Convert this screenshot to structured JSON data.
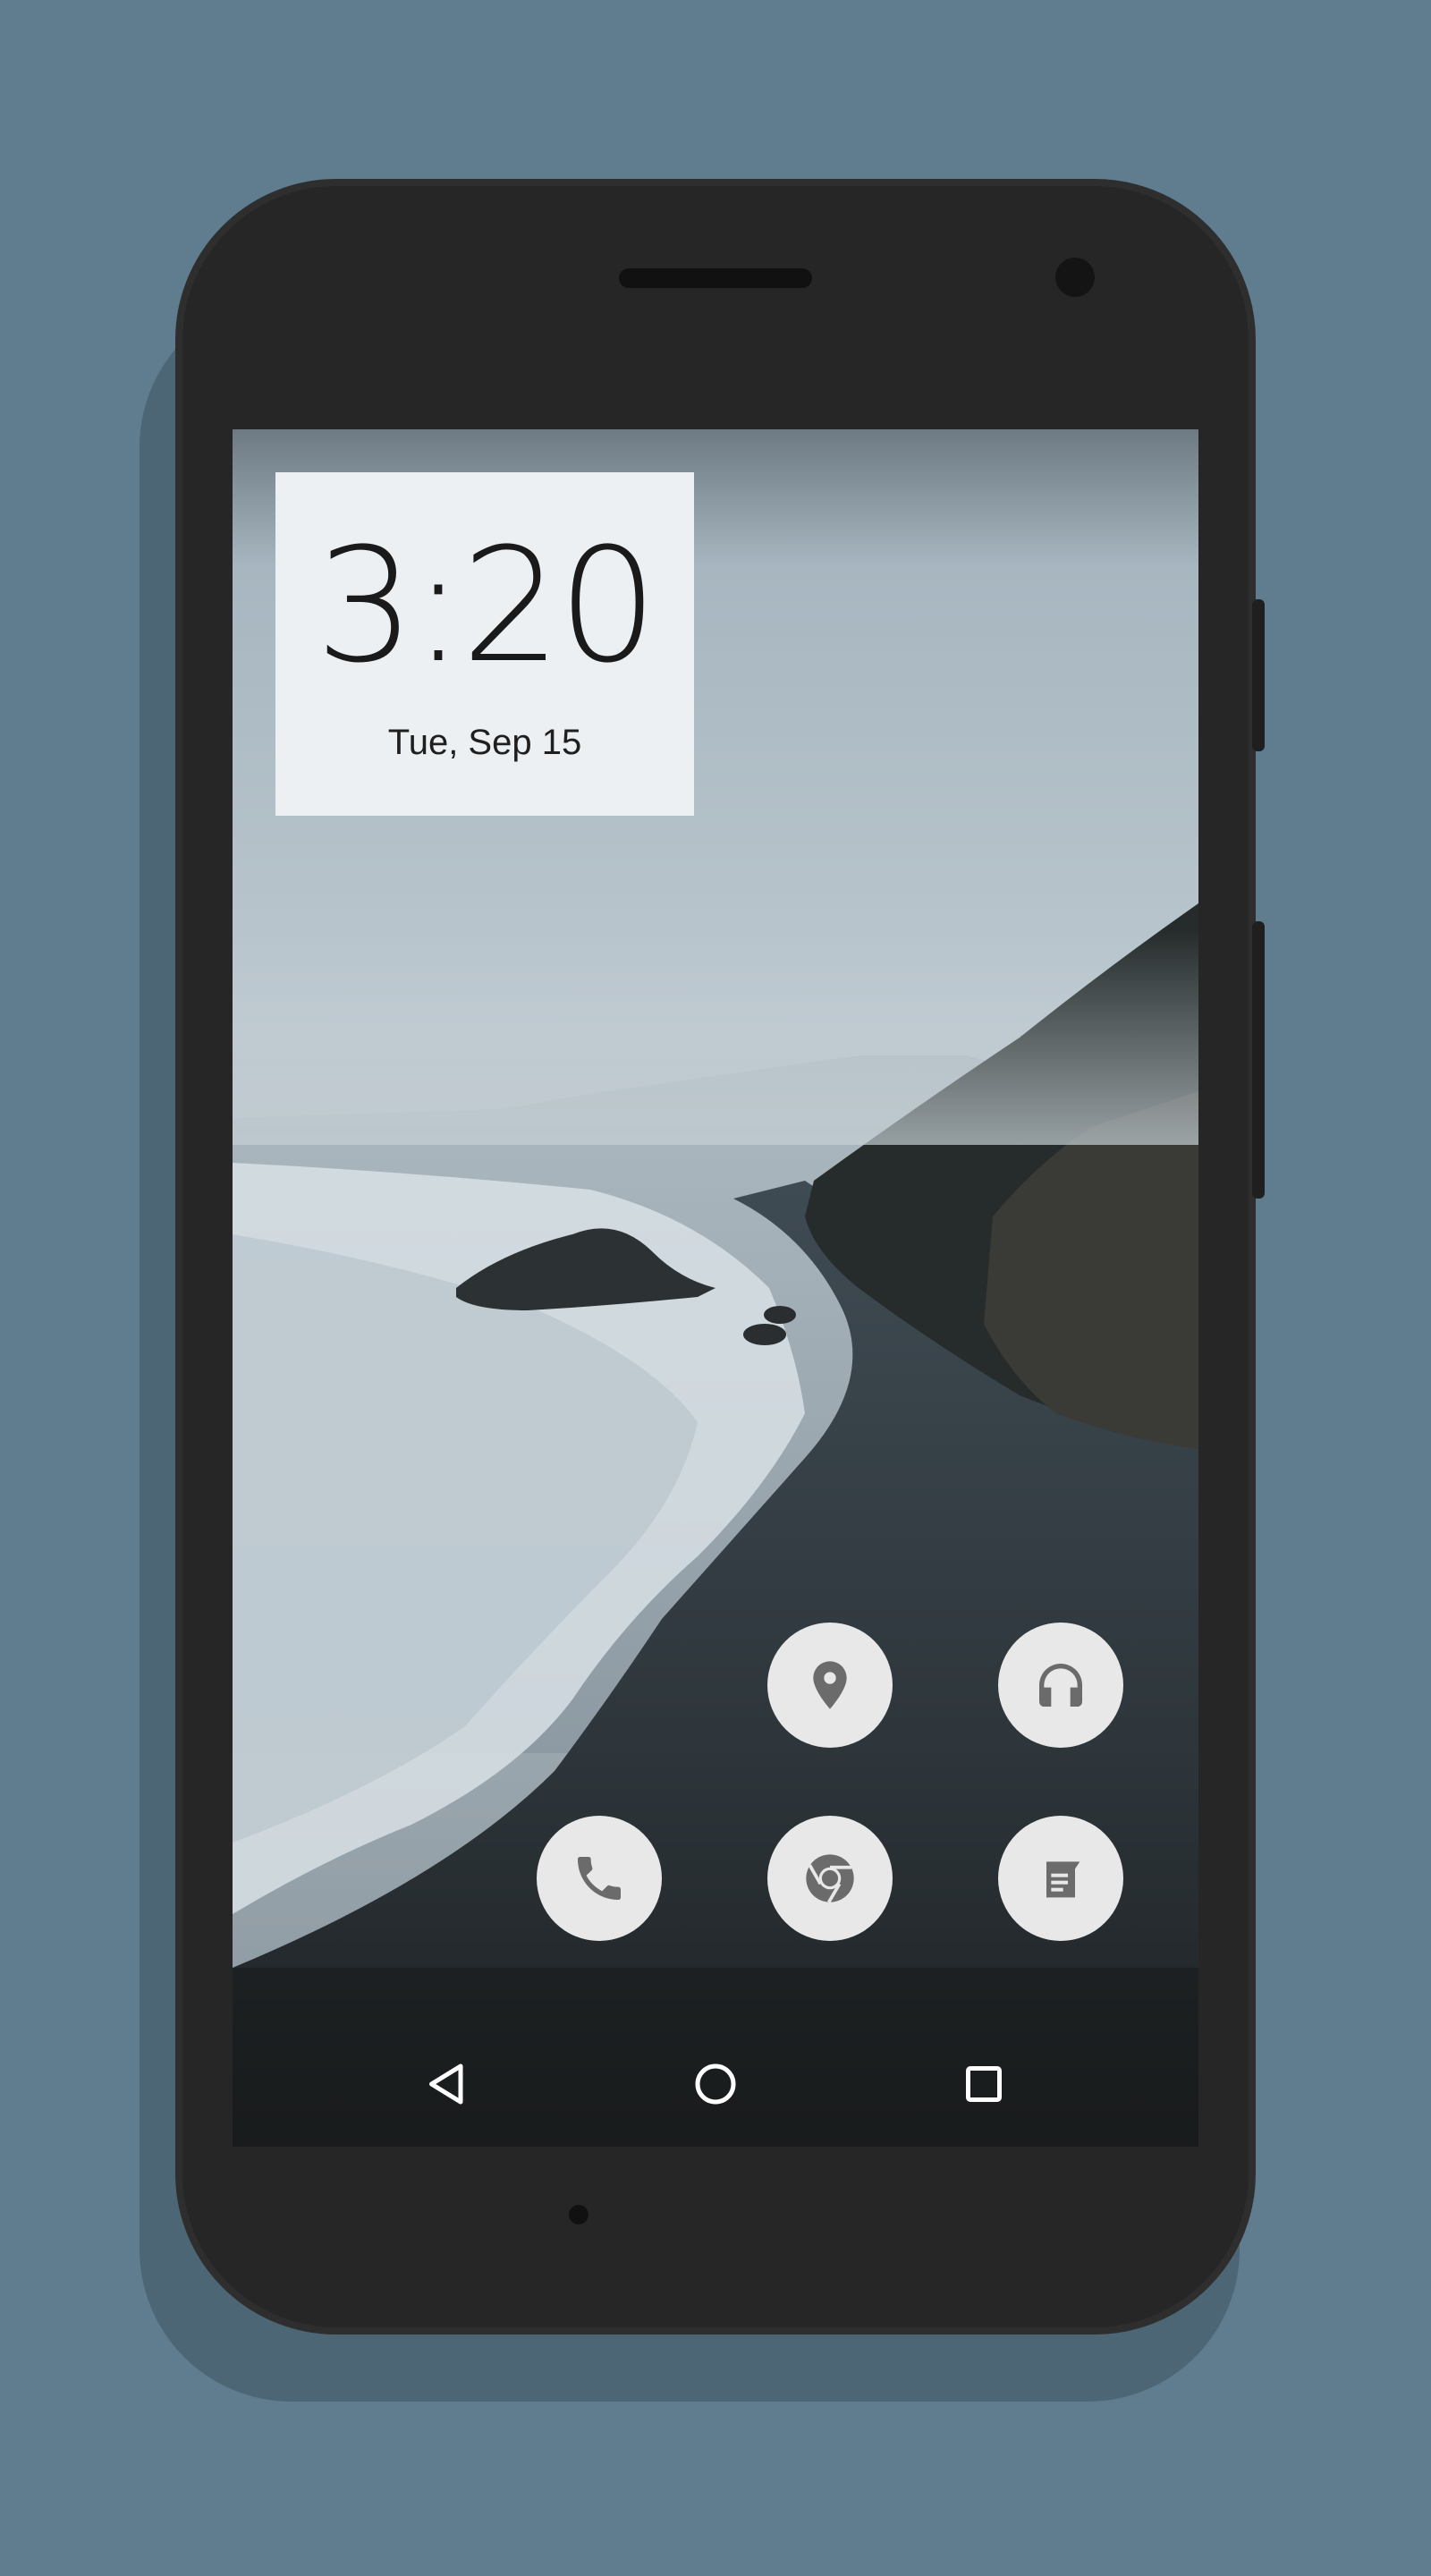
{
  "clock": {
    "time": "3:20",
    "date": "Tue, Sep 15"
  },
  "apps": [
    {
      "id": "maps",
      "icon": "location-pin-icon"
    },
    {
      "id": "music",
      "icon": "headphones-icon"
    },
    {
      "id": "phone",
      "icon": "phone-icon"
    },
    {
      "id": "chrome",
      "icon": "chrome-icon"
    },
    {
      "id": "notes",
      "icon": "notes-icon"
    }
  ],
  "navigation": {
    "back": "back-icon",
    "home": "home-icon",
    "recents": "recents-icon"
  },
  "colors": {
    "background": "#5f7d8e",
    "phone_body": "#262626",
    "widget_bg": "#ecf0f2",
    "icon_bg": "#e8e8e8",
    "icon_fg": "#6b6b6b"
  }
}
